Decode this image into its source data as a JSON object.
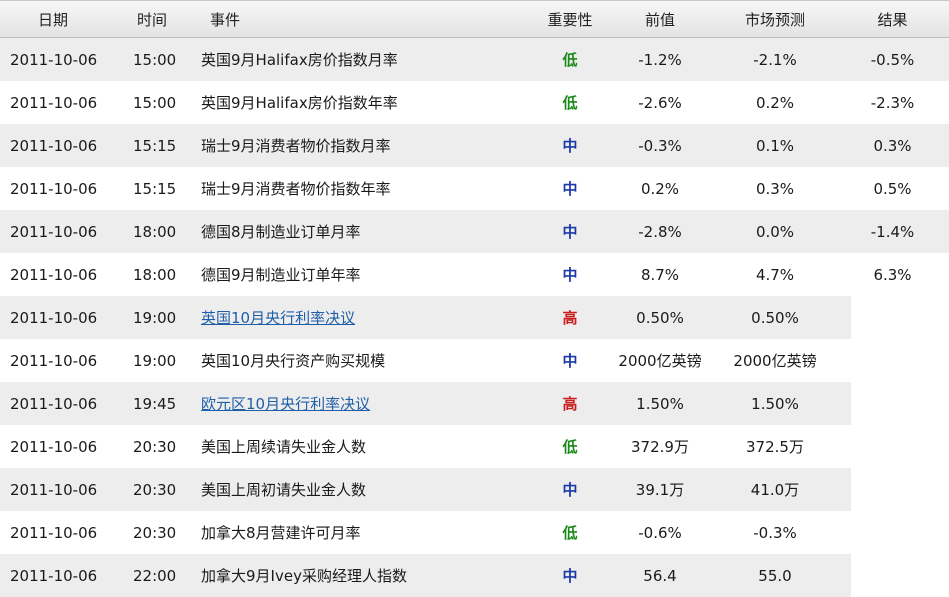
{
  "colors": {
    "low": "#1a8a1a",
    "mid": "#1b3aa8",
    "high": "#c81e1e",
    "link": "#1f5fa8"
  },
  "header": {
    "date": "日期",
    "time": "时间",
    "event": "事件",
    "importance": "重要性",
    "previous": "前值",
    "forecast": "市场预测",
    "result": "结果"
  },
  "rows": [
    {
      "date": "2011-10-06",
      "time": "15:00",
      "event": "英国9月Halifax房价指数月率",
      "link": false,
      "importance": "低",
      "level": "low",
      "previous": "-1.2%",
      "forecast": "-2.1%",
      "result": "-0.5%"
    },
    {
      "date": "2011-10-06",
      "time": "15:00",
      "event": "英国9月Halifax房价指数年率",
      "link": false,
      "importance": "低",
      "level": "low",
      "previous": "-2.6%",
      "forecast": "0.2%",
      "result": "-2.3%"
    },
    {
      "date": "2011-10-06",
      "time": "15:15",
      "event": "瑞士9月消费者物价指数月率",
      "link": false,
      "importance": "中",
      "level": "mid",
      "previous": "-0.3%",
      "forecast": "0.1%",
      "result": "0.3%"
    },
    {
      "date": "2011-10-06",
      "time": "15:15",
      "event": "瑞士9月消费者物价指数年率",
      "link": false,
      "importance": "中",
      "level": "mid",
      "previous": "0.2%",
      "forecast": "0.3%",
      "result": "0.5%"
    },
    {
      "date": "2011-10-06",
      "time": "18:00",
      "event": "德国8月制造业订单月率",
      "link": false,
      "importance": "中",
      "level": "mid",
      "previous": "-2.8%",
      "forecast": "0.0%",
      "result": "-1.4%"
    },
    {
      "date": "2011-10-06",
      "time": "18:00",
      "event": "德国9月制造业订单年率",
      "link": false,
      "importance": "中",
      "level": "mid",
      "previous": "8.7%",
      "forecast": "4.7%",
      "result": "6.3%"
    },
    {
      "date": "2011-10-06",
      "time": "19:00",
      "event": "英国10月央行利率决议",
      "link": true,
      "importance": "高",
      "level": "high",
      "previous": "0.50%",
      "forecast": "0.50%",
      "result": ""
    },
    {
      "date": "2011-10-06",
      "time": "19:00",
      "event": "英国10月央行资产购买规模",
      "link": false,
      "importance": "中",
      "level": "mid",
      "previous": "2000亿英镑",
      "forecast": "2000亿英镑",
      "result": ""
    },
    {
      "date": "2011-10-06",
      "time": "19:45",
      "event": "欧元区10月央行利率决议",
      "link": true,
      "importance": "高",
      "level": "high",
      "previous": "1.50%",
      "forecast": "1.50%",
      "result": ""
    },
    {
      "date": "2011-10-06",
      "time": "20:30",
      "event": "美国上周续请失业金人数",
      "link": false,
      "importance": "低",
      "level": "low",
      "previous": "372.9万",
      "forecast": "372.5万",
      "result": ""
    },
    {
      "date": "2011-10-06",
      "time": "20:30",
      "event": "美国上周初请失业金人数",
      "link": false,
      "importance": "中",
      "level": "mid",
      "previous": "39.1万",
      "forecast": "41.0万",
      "result": ""
    },
    {
      "date": "2011-10-06",
      "time": "20:30",
      "event": "加拿大8月营建许可月率",
      "link": false,
      "importance": "低",
      "level": "low",
      "previous": "-0.6%",
      "forecast": "-0.3%",
      "result": ""
    },
    {
      "date": "2011-10-06",
      "time": "22:00",
      "event": "加拿大9月Ivey采购经理人指数",
      "link": false,
      "importance": "中",
      "level": "mid",
      "previous": "56.4",
      "forecast": "55.0",
      "result": ""
    }
  ]
}
